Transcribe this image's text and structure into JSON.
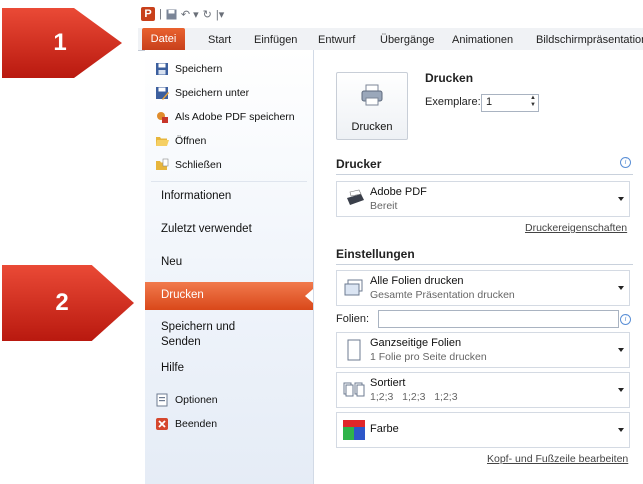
{
  "callouts": {
    "one": "1",
    "two": "2"
  },
  "quick_access": {
    "app_icon": "P"
  },
  "ribbon": {
    "tabs": [
      "Datei",
      "Start",
      "Einfügen",
      "Entwurf",
      "Übergänge",
      "Animationen",
      "Bildschirmpräsentation"
    ]
  },
  "nav": {
    "commands_top": [
      {
        "label": "Speichern",
        "icon": "save-icon"
      },
      {
        "label": "Speichern unter",
        "icon": "save-as-icon"
      },
      {
        "label": "Als Adobe PDF speichern",
        "icon": "pdf-icon"
      },
      {
        "label": "Öffnen",
        "icon": "open-folder-icon"
      },
      {
        "label": "Schließen",
        "icon": "close-file-icon"
      }
    ],
    "pages": [
      "Informationen",
      "Zuletzt verwendet",
      "Neu",
      "Drucken",
      "Speichern und\nSenden",
      "Hilfe"
    ],
    "commands_bottom": [
      {
        "label": "Optionen",
        "icon": "options-icon"
      },
      {
        "label": "Beenden",
        "icon": "exit-icon"
      }
    ]
  },
  "print": {
    "title": "Drucken",
    "button_label": "Drucken",
    "copies_label": "Exemplare:",
    "copies_value": "1"
  },
  "printer": {
    "section": "Drucker",
    "name": "Adobe PDF",
    "status": "Bereit",
    "properties_link": "Druckereigenschaften"
  },
  "settings": {
    "section": "Einstellungen",
    "slides": {
      "main": "Alle Folien drucken",
      "sub": "Gesamte Präsentation drucken"
    },
    "slides_field_label": "Folien:",
    "layout": {
      "main": "Ganzseitige Folien",
      "sub": "1 Folie pro Seite drucken"
    },
    "collate": {
      "main": "Sortiert",
      "sub": "1;2;3   1;2;3   1;2;3"
    },
    "color": {
      "main": "Farbe"
    },
    "header_footer_link": "Kopf- und Fußzeile bearbeiten"
  },
  "colors": {
    "accent": "#d9481a",
    "callout": "#c8281c"
  }
}
